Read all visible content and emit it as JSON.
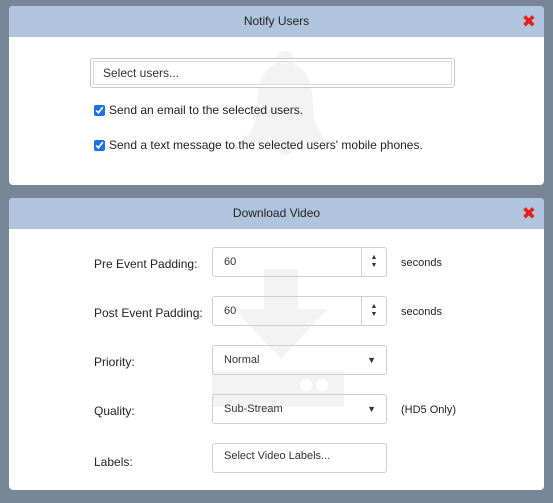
{
  "notify_dialog": {
    "title": "Notify Users",
    "close_icon": "close-x-icon",
    "watermark_icon": "bell-icon",
    "select_users_placeholder": "Select users...",
    "options": [
      {
        "label": "Send an email to the selected users.",
        "checked": true
      },
      {
        "label": "Send a text message to the selected users' mobile phones.",
        "checked": true
      }
    ]
  },
  "download_dialog": {
    "title": "Download Video",
    "close_icon": "close-x-icon",
    "watermark_icon": "download-icon",
    "pre_padding": {
      "label": "Pre Event Padding:",
      "value": "60",
      "unit": "seconds"
    },
    "post_padding": {
      "label": "Post Event Padding:",
      "value": "60",
      "unit": "seconds"
    },
    "priority": {
      "label": "Priority:",
      "value": "Normal"
    },
    "quality": {
      "label": "Quality:",
      "value": "Sub-Stream",
      "note": "(HD5 Only)"
    },
    "labels": {
      "label": "Labels:",
      "placeholder": "Select Video Labels..."
    }
  },
  "colors": {
    "header_bg": "#b0c4de",
    "close_icon": "#e8201a",
    "backdrop": "#778797"
  }
}
